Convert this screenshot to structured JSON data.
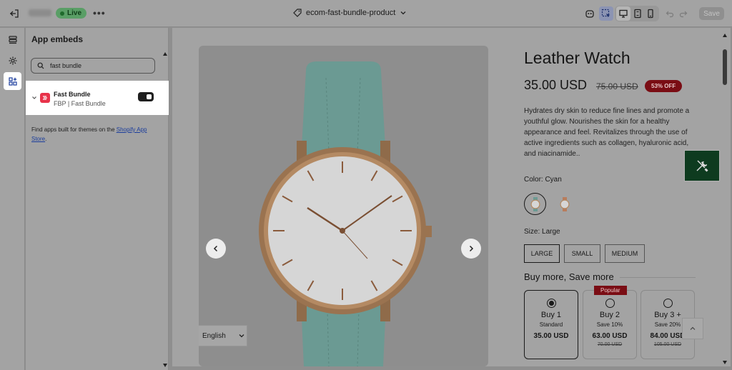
{
  "topbar": {
    "live_label": "Live",
    "more_label": "•••",
    "template_name": "ecom-fast-bundle-product",
    "save_label": "Save"
  },
  "panel": {
    "title": "App embeds",
    "search": {
      "value": "fast bundle"
    },
    "embed": {
      "name": "Fast Bundle",
      "subtitle": "FBP | Fast Bundle",
      "enabled": true
    },
    "find_text": "Find apps built for themes on the ",
    "find_link": "Shopify App Store",
    "find_suffix": "."
  },
  "product": {
    "title": "Leather Watch",
    "price": "35.00 USD",
    "compare_price": "75.00 USD",
    "badge": "53% OFF",
    "description": "Hydrates dry skin to reduce fine lines and promote a youthful glow. Nourishes the skin for a healthy appearance and feel. Revitalizes through the use of active ingredients such as collagen, hyaluronic acid, and niacinamide..",
    "color_label": "Color: Cyan",
    "size_label": "Size: Large",
    "sizes": [
      "LARGE",
      "SMALL",
      "MEDIUM"
    ],
    "language": "English"
  },
  "bundle": {
    "title": "Buy more, Save more",
    "popular_label": "Popular",
    "options": [
      {
        "name": "Buy 1",
        "sub": "Standard",
        "price": "35.00 USD",
        "old": ""
      },
      {
        "name": "Buy 2",
        "sub": "Save 10%",
        "price": "63.00 USD",
        "old": "70.00 USD"
      },
      {
        "name": "Buy 3 +",
        "sub": "Save 20%",
        "price": "84.00 USD",
        "old": "105.00 USD"
      }
    ]
  },
  "colors": {
    "live": "#5a9e66",
    "badge": "#7a0d14",
    "embed_logo": "#e8334a",
    "tool_button": "#0e3b1f"
  }
}
